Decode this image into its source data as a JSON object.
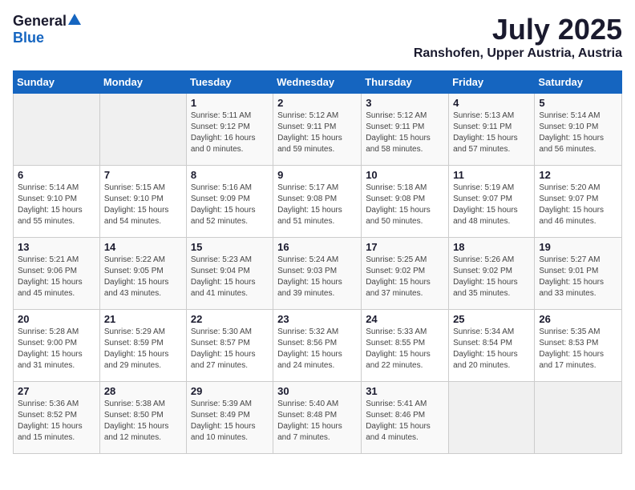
{
  "logo": {
    "general": "General",
    "blue": "Blue"
  },
  "title": "July 2025",
  "location": "Ranshofen, Upper Austria, Austria",
  "days_of_week": [
    "Sunday",
    "Monday",
    "Tuesday",
    "Wednesday",
    "Thursday",
    "Friday",
    "Saturday"
  ],
  "weeks": [
    [
      {
        "day": "",
        "info": ""
      },
      {
        "day": "",
        "info": ""
      },
      {
        "day": "1",
        "info": "Sunrise: 5:11 AM\nSunset: 9:12 PM\nDaylight: 16 hours\nand 0 minutes."
      },
      {
        "day": "2",
        "info": "Sunrise: 5:12 AM\nSunset: 9:11 PM\nDaylight: 15 hours\nand 59 minutes."
      },
      {
        "day": "3",
        "info": "Sunrise: 5:12 AM\nSunset: 9:11 PM\nDaylight: 15 hours\nand 58 minutes."
      },
      {
        "day": "4",
        "info": "Sunrise: 5:13 AM\nSunset: 9:11 PM\nDaylight: 15 hours\nand 57 minutes."
      },
      {
        "day": "5",
        "info": "Sunrise: 5:14 AM\nSunset: 9:10 PM\nDaylight: 15 hours\nand 56 minutes."
      }
    ],
    [
      {
        "day": "6",
        "info": "Sunrise: 5:14 AM\nSunset: 9:10 PM\nDaylight: 15 hours\nand 55 minutes."
      },
      {
        "day": "7",
        "info": "Sunrise: 5:15 AM\nSunset: 9:10 PM\nDaylight: 15 hours\nand 54 minutes."
      },
      {
        "day": "8",
        "info": "Sunrise: 5:16 AM\nSunset: 9:09 PM\nDaylight: 15 hours\nand 52 minutes."
      },
      {
        "day": "9",
        "info": "Sunrise: 5:17 AM\nSunset: 9:08 PM\nDaylight: 15 hours\nand 51 minutes."
      },
      {
        "day": "10",
        "info": "Sunrise: 5:18 AM\nSunset: 9:08 PM\nDaylight: 15 hours\nand 50 minutes."
      },
      {
        "day": "11",
        "info": "Sunrise: 5:19 AM\nSunset: 9:07 PM\nDaylight: 15 hours\nand 48 minutes."
      },
      {
        "day": "12",
        "info": "Sunrise: 5:20 AM\nSunset: 9:07 PM\nDaylight: 15 hours\nand 46 minutes."
      }
    ],
    [
      {
        "day": "13",
        "info": "Sunrise: 5:21 AM\nSunset: 9:06 PM\nDaylight: 15 hours\nand 45 minutes."
      },
      {
        "day": "14",
        "info": "Sunrise: 5:22 AM\nSunset: 9:05 PM\nDaylight: 15 hours\nand 43 minutes."
      },
      {
        "day": "15",
        "info": "Sunrise: 5:23 AM\nSunset: 9:04 PM\nDaylight: 15 hours\nand 41 minutes."
      },
      {
        "day": "16",
        "info": "Sunrise: 5:24 AM\nSunset: 9:03 PM\nDaylight: 15 hours\nand 39 minutes."
      },
      {
        "day": "17",
        "info": "Sunrise: 5:25 AM\nSunset: 9:02 PM\nDaylight: 15 hours\nand 37 minutes."
      },
      {
        "day": "18",
        "info": "Sunrise: 5:26 AM\nSunset: 9:02 PM\nDaylight: 15 hours\nand 35 minutes."
      },
      {
        "day": "19",
        "info": "Sunrise: 5:27 AM\nSunset: 9:01 PM\nDaylight: 15 hours\nand 33 minutes."
      }
    ],
    [
      {
        "day": "20",
        "info": "Sunrise: 5:28 AM\nSunset: 9:00 PM\nDaylight: 15 hours\nand 31 minutes."
      },
      {
        "day": "21",
        "info": "Sunrise: 5:29 AM\nSunset: 8:59 PM\nDaylight: 15 hours\nand 29 minutes."
      },
      {
        "day": "22",
        "info": "Sunrise: 5:30 AM\nSunset: 8:57 PM\nDaylight: 15 hours\nand 27 minutes."
      },
      {
        "day": "23",
        "info": "Sunrise: 5:32 AM\nSunset: 8:56 PM\nDaylight: 15 hours\nand 24 minutes."
      },
      {
        "day": "24",
        "info": "Sunrise: 5:33 AM\nSunset: 8:55 PM\nDaylight: 15 hours\nand 22 minutes."
      },
      {
        "day": "25",
        "info": "Sunrise: 5:34 AM\nSunset: 8:54 PM\nDaylight: 15 hours\nand 20 minutes."
      },
      {
        "day": "26",
        "info": "Sunrise: 5:35 AM\nSunset: 8:53 PM\nDaylight: 15 hours\nand 17 minutes."
      }
    ],
    [
      {
        "day": "27",
        "info": "Sunrise: 5:36 AM\nSunset: 8:52 PM\nDaylight: 15 hours\nand 15 minutes."
      },
      {
        "day": "28",
        "info": "Sunrise: 5:38 AM\nSunset: 8:50 PM\nDaylight: 15 hours\nand 12 minutes."
      },
      {
        "day": "29",
        "info": "Sunrise: 5:39 AM\nSunset: 8:49 PM\nDaylight: 15 hours\nand 10 minutes."
      },
      {
        "day": "30",
        "info": "Sunrise: 5:40 AM\nSunset: 8:48 PM\nDaylight: 15 hours\nand 7 minutes."
      },
      {
        "day": "31",
        "info": "Sunrise: 5:41 AM\nSunset: 8:46 PM\nDaylight: 15 hours\nand 4 minutes."
      },
      {
        "day": "",
        "info": ""
      },
      {
        "day": "",
        "info": ""
      }
    ]
  ]
}
